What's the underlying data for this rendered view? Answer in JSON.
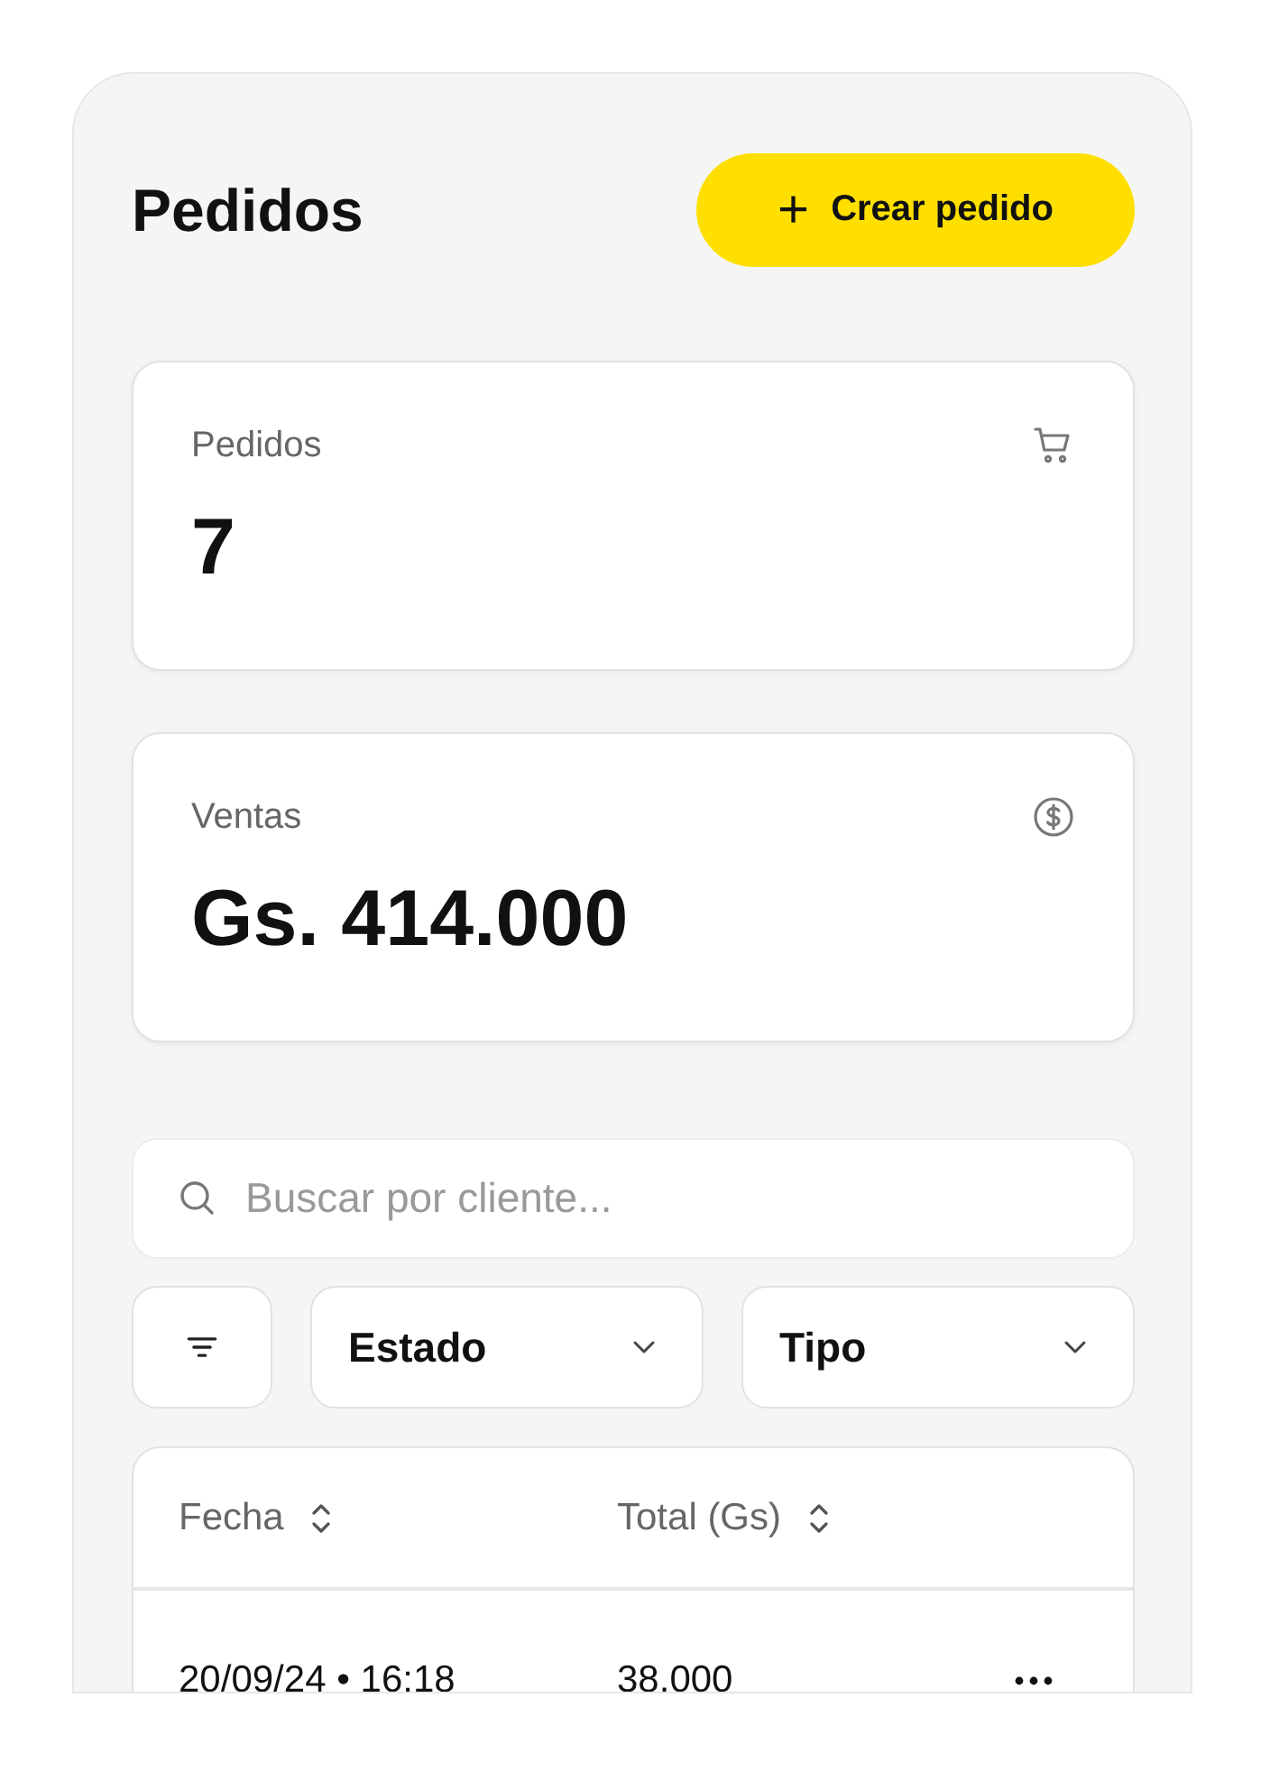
{
  "header": {
    "title": "Pedidos",
    "create_button": {
      "icon": "+",
      "label": "Crear pedido"
    }
  },
  "stats": [
    {
      "label": "Pedidos",
      "value": "7",
      "kind": "cart"
    },
    {
      "label": "Ventas",
      "value": "Gs. 414.000",
      "kind": "dollar"
    }
  ],
  "search": {
    "placeholder": "Buscar por cliente..."
  },
  "filters": [
    {
      "label": "Estado"
    },
    {
      "label": "Tipo"
    }
  ],
  "table": {
    "columns": [
      "Fecha",
      "Total (Gs)"
    ],
    "rows": [
      {
        "date": "20/09/24 • 16:18",
        "total": "38.000"
      }
    ]
  }
}
